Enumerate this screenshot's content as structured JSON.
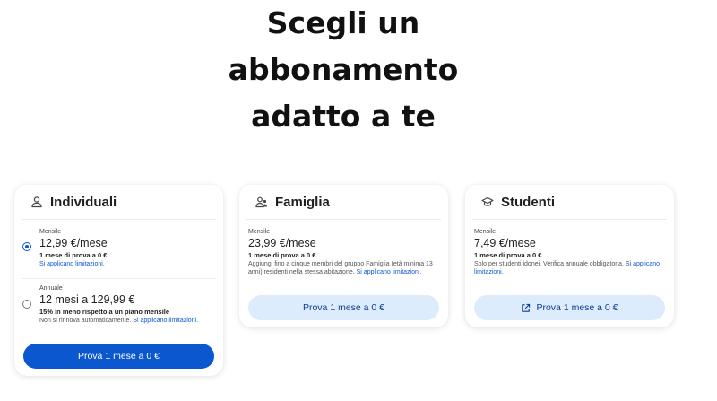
{
  "hero": {
    "line1": "Scegli un",
    "line2": "abbonamento",
    "line3": "adatto a te"
  },
  "cards": {
    "individual": {
      "icon": "person-icon",
      "title": "Individuali",
      "monthly": {
        "kicker": "Mensile",
        "price": "12,99 €/mese",
        "trial": "1 mese di prova a 0 €",
        "limits": "Si applicano limitazioni."
      },
      "annual": {
        "kicker": "Annuale",
        "price": "12 mesi a 129,99 €",
        "savings": "15% in meno rispetto a un piano mensile",
        "note": "Non si rinnova automaticamente.",
        "limits": "Si applicano limitazioni."
      },
      "button": "Prova 1 mese a 0 €"
    },
    "family": {
      "icon": "family-icon",
      "title": "Famiglia",
      "kicker": "Mensile",
      "price": "23,99 €/mese",
      "trial": "1 mese di prova a 0 €",
      "note": "Aggiungi fino a cinque membri del gruppo Famiglia (età minima 13 anni) residenti nella stessa abitazione.",
      "limits": "Si applicano limitazioni.",
      "button": "Prova 1 mese a 0 €"
    },
    "students": {
      "icon": "graduation-cap-icon",
      "title": "Studenti",
      "kicker": "Mensile",
      "price": "7,49 €/mese",
      "trial": "1 mese di prova a 0 €",
      "note": "Solo per studenti idonei. Verifica annuale obbligatoria.",
      "limits": "Si applicano limitazioni.",
      "button": "Prova 1 mese a 0 €",
      "button_icon": "external-link-icon"
    }
  },
  "colors": {
    "accent": "#0b57d0",
    "light_button": "#dcecfc"
  }
}
